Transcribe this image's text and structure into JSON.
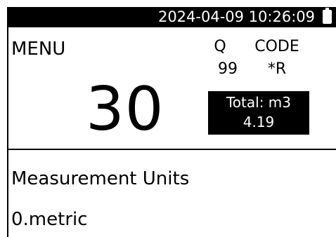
{
  "status_bar": {
    "datetime": "2024-04-09 10:26:09",
    "battery_icon": "battery-icon"
  },
  "header": {
    "menu_label": "MENU",
    "q_label": "Q",
    "q_value": "99",
    "code_label": "CODE",
    "code_value": "*R"
  },
  "main": {
    "menu_number": "30",
    "total_label": "Total: m3",
    "total_value": "4.19"
  },
  "parameter": {
    "title": "Measurement Units",
    "value": "0.metric"
  },
  "colors": {
    "background": "#ffffff",
    "foreground": "#000000"
  }
}
